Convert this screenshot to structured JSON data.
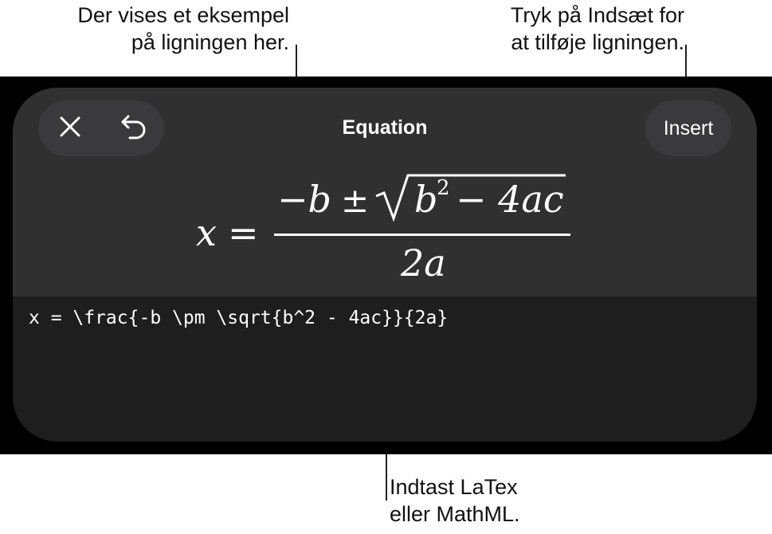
{
  "callouts": {
    "preview": {
      "line1": "Der vises et eksempel",
      "line2": "på ligningen her."
    },
    "insert": {
      "line1": "Tryk på Indsæt for",
      "line2": "at tilføje ligningen."
    },
    "input": {
      "line1": "Indtast LaTex",
      "line2": "eller MathML."
    }
  },
  "toolbar": {
    "close_icon": "close-icon",
    "undo_icon": "undo-icon",
    "title": "Equation",
    "insert_label": "Insert"
  },
  "preview": {
    "lhs": "x",
    "equals": "=",
    "numerator_minus_b": "−b",
    "plus_minus": "±",
    "b": "b",
    "exponent": "2",
    "minus_4ac": "− 4ac",
    "denominator": "2a"
  },
  "input": {
    "value": "x = \\frac{-b \\pm \\sqrt{b^2 - 4ac}}{2a}"
  },
  "colors": {
    "screen_background": "#000000",
    "sheet_background": "#1e1e1f",
    "preview_background": "#303031",
    "button_background": "#3a3a3c",
    "text": "#ffffff"
  }
}
